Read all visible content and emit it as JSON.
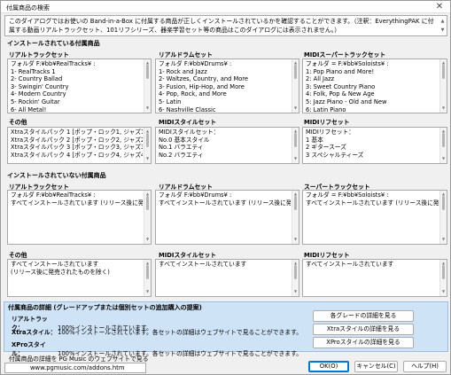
{
  "window": {
    "title": "付属商品の検索",
    "close_glyph": "✕"
  },
  "description": "このダイアログではお使いの Band-in-a-Box に付属する商品が正しくインストールされているかを確認することができます。（注釈：EverythingPAK に付属する動画リアルトラックセット、101リフシリーズ、器楽学習セット等の商品はこのダイアログには表示されません。）",
  "installed": {
    "header": "インストールされている付属商品",
    "realtracks": {
      "label": "リアルトラックセット",
      "lines": [
        "フォルダ  F:¥bb¥RealTracks¥ :",
        "1- RealTracks 1",
        "2- Country Ballad",
        "3- Swingin' Country",
        "4- Modern Country",
        "5- Rockin' Guitar",
        "6- All Metal!"
      ]
    },
    "realdrums": {
      "label": "リアルドラムセット",
      "lines": [
        "フォルダ  F:¥bb¥Drums¥ :",
        "1- Rock and Jazz",
        "2- Waltzes, Country, and More",
        "3- Fusion, Hip-Hop, and More",
        "4- Pop, Rock, and More",
        "5- Latin",
        "6- Nashville Classic"
      ]
    },
    "midisuper": {
      "label": "MIDIスーパートラックセット",
      "lines": [
        "フォルダ = F:¥bb¥Soloists¥ :",
        "1: Pop Piano and More!",
        "2: All Jazz",
        "3: Sweet Country Piano",
        "4: Folk, Pop & New Age",
        "5: Jazz Piano - Old and New",
        "6: Latin Piano"
      ]
    },
    "other": {
      "label": "その他",
      "lines": [
        "Xtraスタイルパック 1 [ポップ・ロック1, ジャズ1, カントリ",
        "Xtraスタイルパック 2 [ポップ・ロック2, ジャズ2, カントリ",
        "Xtraスタイルパック 3 [ポップ・ロック3, ジャズ3, カントリ",
        "Xtraスタイルパック 4 [ポップ・ロック4, ジャズ4, カントリ"
      ]
    },
    "midistyle": {
      "label": "MIDIスタイルセット",
      "lines": [
        "MIDIスタイルセット：",
        "No.0 基本スタイル",
        "No.1 バラエティ",
        "No.2 バラエティ"
      ]
    },
    "midiriff": {
      "label": "MIDIリフセット",
      "lines": [
        "MIDIリフセット：",
        "1 基本",
        "2 ギタースーズ",
        "3 スペシャルティーズ"
      ]
    }
  },
  "not_installed": {
    "header": "インストールされていない付属商品",
    "realtracks": {
      "label": "リアルトラックセット",
      "lines": [
        "フォルダ  F:¥bb¥RealTracks¥ :",
        "すべてインストールされています (リリース後に発売されたものを除く)"
      ]
    },
    "realdrums": {
      "label": "リアルドラムセット",
      "lines": [
        "フォルダ  F:¥bb¥Drums¥ :",
        "すべてインストールされています (リリース後に発売されたものを除く)"
      ]
    },
    "supertracks": {
      "label": "スーパートラックセット",
      "lines": [
        "フォルダ = F:¥bb¥Soloists¥ :",
        "すべてインストールされています (リリース後に発売されたものを除く)"
      ]
    },
    "other": {
      "label": "その他",
      "lines": [
        "すべてインストールされています",
        "(リリース後に発売されたものを除く)"
      ]
    },
    "midistyle": {
      "label": "MIDIスタイルセット",
      "lines": [
        "すべてインストールされています"
      ]
    },
    "midiriff": {
      "label": "MIDIリフセット",
      "lines": [
        "すべてインストールされています"
      ]
    }
  },
  "details": {
    "header": "付属商品の詳細 (グレードアップまたは個別セットの追加購入の提案)",
    "rows": [
      {
        "label": "リアルトラック：",
        "text": "100%インストールされています。"
      },
      {
        "label": "Xtraスタイル：",
        "text": "100%インストールされています。各セットの詳細はウェブサイトで見ることができます。"
      },
      {
        "label": "XProスタイル：",
        "text": "100%インストールされています。各セットの詳細はウェブサイトで見ることができます。"
      }
    ],
    "buttons": [
      "各グレードの詳細を見る",
      "Xtraスタイルの詳細を見る",
      "XProスタイルの詳細を見る"
    ]
  },
  "footer": {
    "label": "付属商品の詳細を PG Music のウェブサイトで見る",
    "url_button": "www.pgmusic.com/addons.htm",
    "ok": "OK(O)",
    "cancel": "キャンセル(C)",
    "help": "ヘルプ(H)"
  }
}
